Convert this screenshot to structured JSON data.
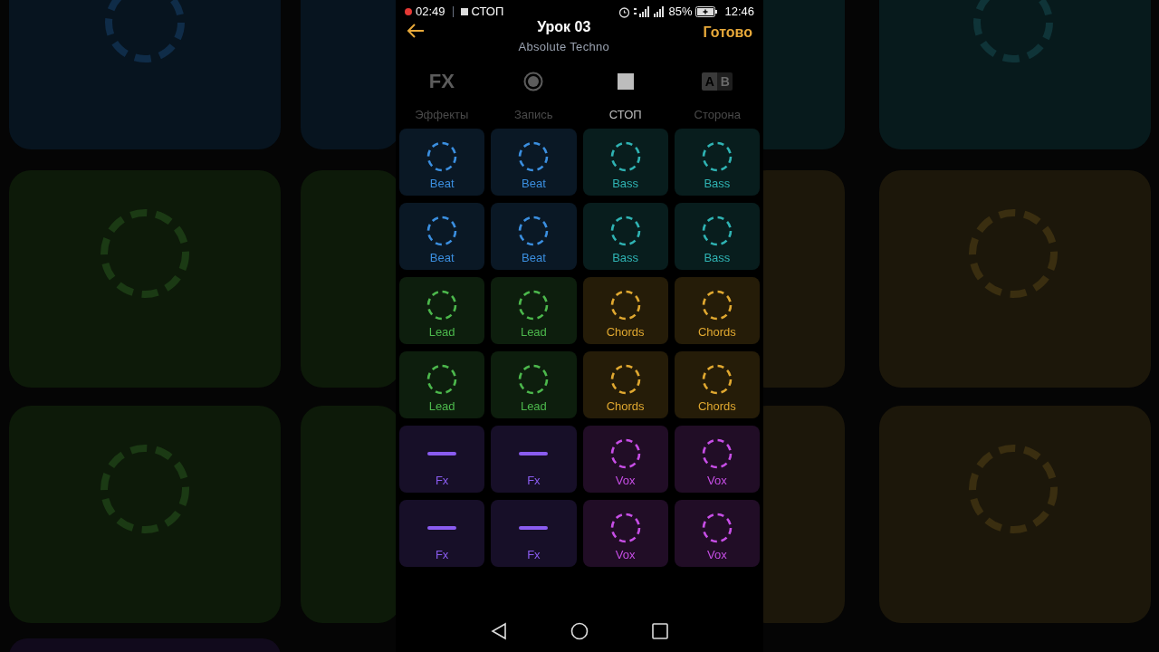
{
  "status_bar": {
    "recording_time": "02:49",
    "recording_state": "СТОП",
    "battery": "85%",
    "clock": "12:46"
  },
  "header": {
    "title": "Урок 03",
    "subtitle": "Absolute Techno",
    "done": "Готово"
  },
  "toolbar": [
    {
      "kind": "fx",
      "glyph": "FX",
      "label": "Эффекты",
      "selected": false
    },
    {
      "kind": "record",
      "label": "Запись",
      "selected": false
    },
    {
      "kind": "stop",
      "label": "СТОП",
      "selected": true
    },
    {
      "kind": "side",
      "glyph_a": "A",
      "glyph_b": "B",
      "label": "Сторона",
      "selected": false
    }
  ],
  "pads": [
    {
      "label": "Beat",
      "kind": "loop",
      "color": "#3b8fe0"
    },
    {
      "label": "Beat",
      "kind": "loop",
      "color": "#3b8fe0"
    },
    {
      "label": "Bass",
      "kind": "loop",
      "color": "#2fb3b3"
    },
    {
      "label": "Bass",
      "kind": "loop",
      "color": "#2fb3b3"
    },
    {
      "label": "Beat",
      "kind": "loop",
      "color": "#3b8fe0"
    },
    {
      "label": "Beat",
      "kind": "loop",
      "color": "#3b8fe0"
    },
    {
      "label": "Bass",
      "kind": "loop",
      "color": "#2fb3b3"
    },
    {
      "label": "Bass",
      "kind": "loop",
      "color": "#2fb3b3"
    },
    {
      "label": "Lead",
      "kind": "loop",
      "color": "#4cb84c"
    },
    {
      "label": "Lead",
      "kind": "loop",
      "color": "#4cb84c"
    },
    {
      "label": "Chords",
      "kind": "loop",
      "color": "#e0a830"
    },
    {
      "label": "Chords",
      "kind": "loop",
      "color": "#e0a830"
    },
    {
      "label": "Lead",
      "kind": "loop",
      "color": "#4cb84c"
    },
    {
      "label": "Lead",
      "kind": "loop",
      "color": "#4cb84c"
    },
    {
      "label": "Chords",
      "kind": "loop",
      "color": "#e0a830"
    },
    {
      "label": "Chords",
      "kind": "loop",
      "color": "#e0a830"
    },
    {
      "label": "Fx",
      "kind": "oneshot",
      "color": "#8a5cf0"
    },
    {
      "label": "Fx",
      "kind": "oneshot",
      "color": "#8a5cf0"
    },
    {
      "label": "Vox",
      "kind": "loop",
      "color": "#c74ee6"
    },
    {
      "label": "Vox",
      "kind": "loop",
      "color": "#c74ee6"
    },
    {
      "label": "Fx",
      "kind": "oneshot",
      "color": "#8a5cf0"
    },
    {
      "label": "Fx",
      "kind": "oneshot",
      "color": "#8a5cf0"
    },
    {
      "label": "Vox",
      "kind": "loop",
      "color": "#c74ee6"
    },
    {
      "label": "Vox",
      "kind": "loop",
      "color": "#c74ee6"
    }
  ]
}
